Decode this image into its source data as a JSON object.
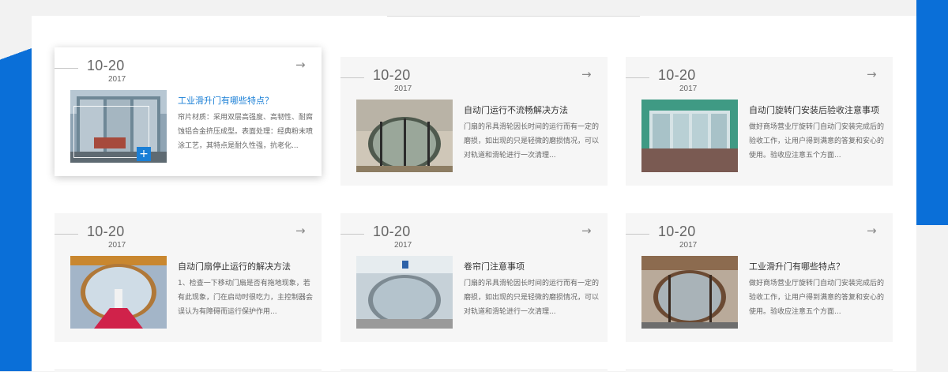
{
  "cards": [
    {
      "date": "10-20",
      "year": "2017",
      "title": "工业滑升门有哪些特点？",
      "desc": "帘片材质：采用双层高强度、高韧性、耐腐蚀铝合金挤压成型。表面处理：经典粉末喷涂工艺，其特点是耐久性强，抗老化...",
      "plus": "+"
    },
    {
      "date": "10-20",
      "year": "2017",
      "title": "自动门运行不流畅解决方法",
      "desc": "门扇的吊具滑轮因长时间的运行而有一定的磨损，如出现的只是轻微的磨损情况，可以对轨道和滑轮进行一次清理..."
    },
    {
      "date": "10-20",
      "year": "2017",
      "title": "自动门旋转门安装后验收注意事项",
      "desc": "做好商场营业厅旋转门自动门安装完成后的验收工作，让用户得到满意的答复和安心的使用。验收应注意五个方面..."
    },
    {
      "date": "10-20",
      "year": "2017",
      "title": "自动门扇停止运行的解决方法",
      "desc": "1、检查一下移动门扇是否有拖地现象，若有此现象，门在启动时很吃力，主控制器会误认为有障碍而运行保护作用..."
    },
    {
      "date": "10-20",
      "year": "2017",
      "title": "卷帘门注意事项",
      "desc": "门扇的吊具滑轮因长时间的运行而有一定的磨损，如出现的只是轻微的磨损情况，可以对轨道和滑轮进行一次清理..."
    },
    {
      "date": "10-20",
      "year": "2017",
      "title": "工业滑升门有哪些特点？",
      "desc": "做好商场营业厅旋转门自动门安装完成后的验收工作，让用户得到满意的答复和安心的使用。验收应注意五个方面..."
    }
  ],
  "icons": {
    "arrow": "arrow-right-icon",
    "plus": "plus-icon"
  },
  "colors": {
    "accent": "#1a7fd6",
    "brand_blue": "#0a6fd8"
  }
}
